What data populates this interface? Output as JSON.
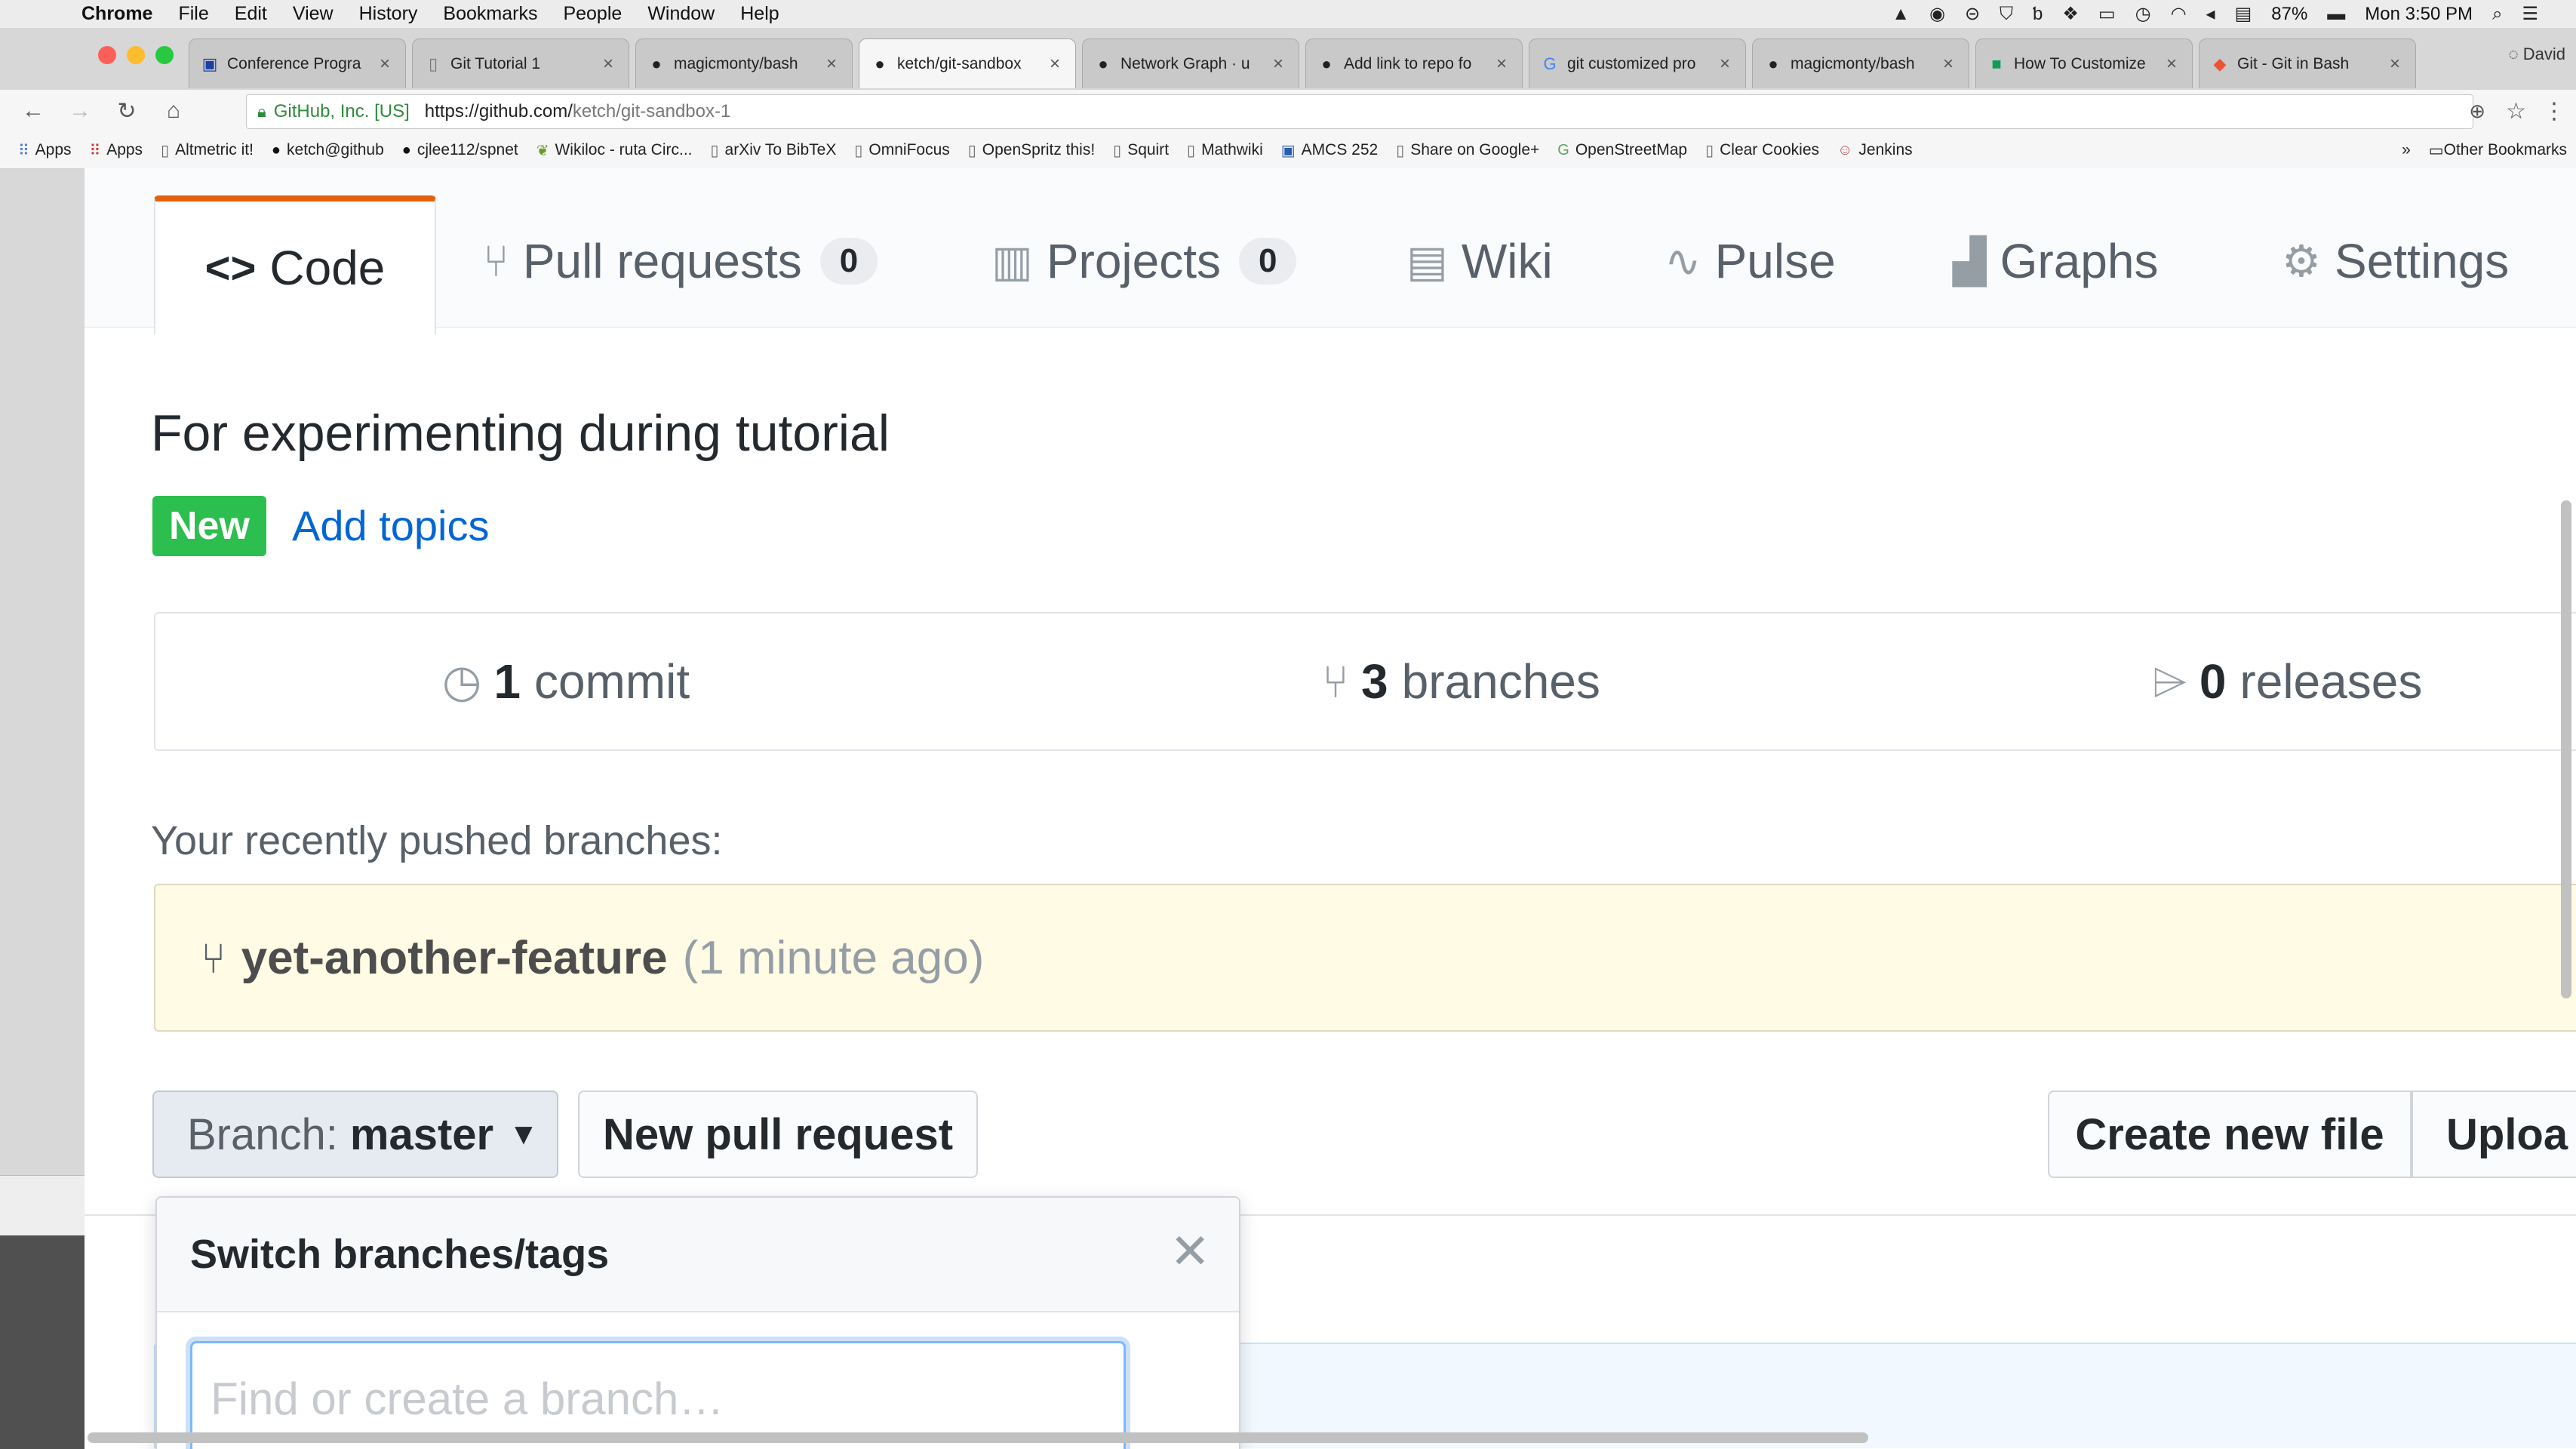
{
  "menubar": {
    "app": "Chrome",
    "items": [
      "File",
      "Edit",
      "View",
      "History",
      "Bookmarks",
      "People",
      "Window",
      "Help"
    ],
    "battery": "87%",
    "clock": "Mon 3:50 PM"
  },
  "browser": {
    "tabs": [
      {
        "label": "Conference Progra",
        "icon": "conference-icon"
      },
      {
        "label": "Git Tutorial 1",
        "icon": "page-icon"
      },
      {
        "label": "magicmonty/bash",
        "icon": "github-icon"
      },
      {
        "label": "ketch/git-sandbox",
        "icon": "github-icon",
        "active": true
      },
      {
        "label": "Network Graph · u",
        "icon": "github-icon"
      },
      {
        "label": "Add link to repo fo",
        "icon": "github-icon"
      },
      {
        "label": "git customized pro",
        "icon": "google-icon"
      },
      {
        "label": "magicmonty/bash",
        "icon": "github-icon"
      },
      {
        "label": "How To Customize",
        "icon": "sheet-icon"
      },
      {
        "label": "Git - Git in Bash",
        "icon": "git-icon"
      }
    ],
    "profile": "David",
    "site_identity": "GitHub, Inc. [US]",
    "url_host": "https://github.com/",
    "url_path": "ketch/git-sandbox-1",
    "bookmarks": [
      "Apps",
      "Apps",
      "Altmetric it!",
      "ketch@github",
      "cjlee112/spnet",
      "Wikiloc - ruta Circ...",
      "arXiv To BibTeX",
      "OmniFocus",
      "OpenSpritz this!",
      "Squirt",
      "Mathwiki",
      "AMCS 252",
      "Share on Google+",
      "OpenStreetMap",
      "Clear Cookies",
      "Jenkins"
    ],
    "other_bookmarks": "Other Bookmarks"
  },
  "repo": {
    "nav": {
      "code": "Code",
      "pull_requests": "Pull requests",
      "pull_requests_count": "0",
      "projects": "Projects",
      "projects_count": "0",
      "wiki": "Wiki",
      "pulse": "Pulse",
      "graphs": "Graphs",
      "settings": "Settings"
    },
    "description": "For experimenting during tutorial",
    "new_badge": "New",
    "add_topics": "Add topics",
    "summary": {
      "commits_num": "1",
      "commits_label": "commit",
      "branches_num": "3",
      "branches_label": "branches",
      "releases_num": "0",
      "releases_label": "releases"
    },
    "recent_label": "Your recently pushed branches:",
    "recent_branch": "yet-another-feature",
    "recent_ago": "(1 minute ago)",
    "branch_button_label": "Branch:",
    "branch_button_value": "master",
    "new_pull_request": "New pull request",
    "create_new_file": "Create new file",
    "upload": "Uploa",
    "dropdown": {
      "title": "Switch branches/tags",
      "placeholder": "Find or create a branch…"
    }
  }
}
